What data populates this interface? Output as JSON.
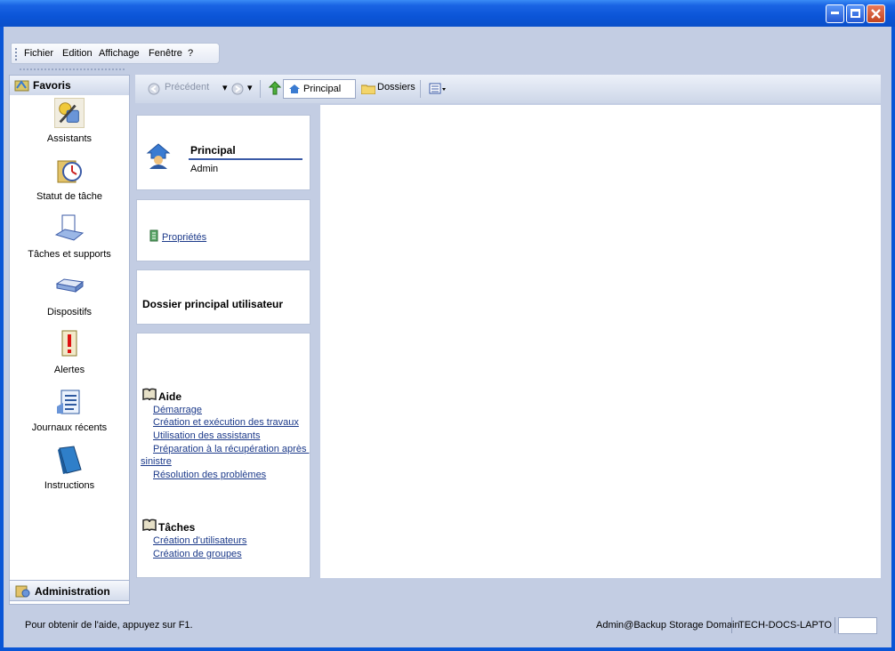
{
  "menu": {
    "items": [
      "Fichier",
      "Edition",
      "Affichage",
      "Fenêtre",
      "?"
    ]
  },
  "nav": {
    "header": "Favoris",
    "items": [
      {
        "label": "Assistants",
        "icon": "wizard-icon"
      },
      {
        "label": "Statut de tâche",
        "icon": "task-status-icon"
      },
      {
        "label": "Tâches et supports",
        "icon": "tasks-media-icon"
      },
      {
        "label": "Dispositifs",
        "icon": "device-icon"
      },
      {
        "label": "Alertes",
        "icon": "alert-icon"
      },
      {
        "label": "Journaux récents",
        "icon": "logs-icon"
      },
      {
        "label": "Instructions",
        "icon": "instructions-icon"
      }
    ],
    "footer": "Administration"
  },
  "toolbar": {
    "back": "Précédent",
    "principal": "Principal",
    "dossiers": "Dossiers"
  },
  "panel_principal": {
    "title": "Principal",
    "subtitle": "Admin"
  },
  "panel_props": {
    "link": "Propriétés"
  },
  "panel_dossier": {
    "title": "Dossier principal utilisateur"
  },
  "panel_help": {
    "aide_title": "Aide",
    "aide_links": [
      "Démarrage",
      "Création et exécution des travaux",
      "Utilisation des assistants",
      "Préparation à la récupération après ",
      "sinistre",
      "Résolution des problèmes"
    ],
    "taches_title": "Tâches",
    "taches_links": [
      "Création d'utilisateurs",
      "Création de groupes"
    ]
  },
  "status": {
    "help": "Pour obtenir de l'aide, appuyez sur F1.",
    "user": "Admin@Backup Storage Domain",
    "machine": "TECH-DOCS-LAPTO"
  }
}
